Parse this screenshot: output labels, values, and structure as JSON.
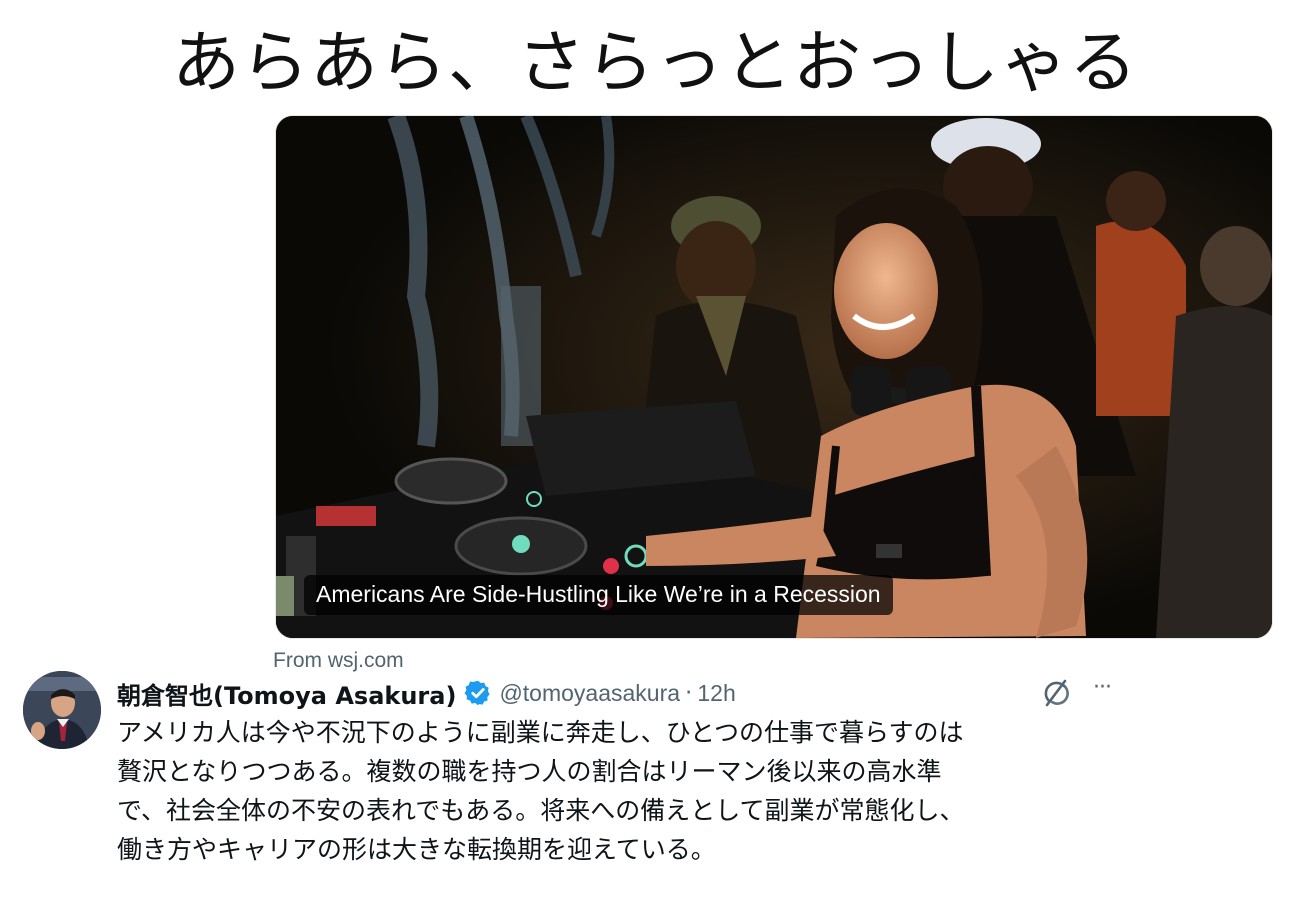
{
  "meme_caption": "あらあら、さらっとおっしゃる",
  "link_card": {
    "headline": "Americans Are Side-Hustling Like We’re in a Recession",
    "source": "From wsj.com"
  },
  "tweet": {
    "display_name": "朝倉智也(Tomoya Asakura)",
    "handle": "@tomoyaasakura",
    "separator": "·",
    "time": "12h",
    "more_label": "···",
    "lines": [
      "アメリカ人は今や不況下のように副業に奔走し、ひとつの仕事で暮らすのは",
      "贅沢となりつつある。複数の職を持つ人の割合はリーマン後以来の高水準",
      "で、社会全体の不安の表れでもある。将来への備えとして副業が常態化し、",
      "働き方やキャリアの形は大きな転換期を迎えている。"
    ]
  },
  "colors": {
    "verified_badge": "#1d9bf0",
    "secondary_text": "#536471",
    "primary_text": "#0f1419",
    "photo_dark": "#0d0b07"
  },
  "icons": [
    "verified-badge-icon",
    "grok-icon",
    "more-icon"
  ]
}
